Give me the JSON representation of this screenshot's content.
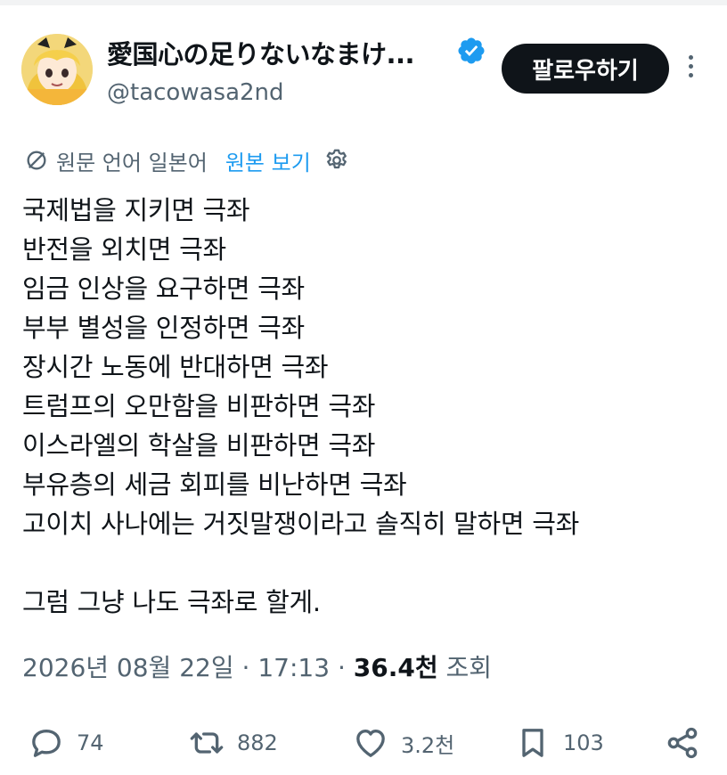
{
  "author": {
    "display_name": "愛国心の足りないなまけ...",
    "handle": "@tacowasa2nd"
  },
  "follow_label": "팔로우하기",
  "translation": {
    "original_language": "원문 언어 일본어",
    "view_original": "원본 보기"
  },
  "tweet_lines": [
    "국제법을 지키면 극좌",
    "반전을 외치면 극좌",
    "임금 인상을 요구하면 극좌",
    "부부 별성을 인정하면 극좌",
    "장시간 노동에 반대하면 극좌",
    "트럼프의 오만함을 비판하면 극좌",
    "이스라엘의 학살을 비판하면 극좌",
    "부유층의 세금 회피를 비난하면 극좌",
    "고이치 사나에는 거짓말쟁이라고 솔직히 말하면 극좌",
    "그럼 그냥 나도 극좌로 할게."
  ],
  "meta": {
    "date": "2026년 08월 22일",
    "time": "17:13",
    "views_count": "36.4천",
    "views_label": "조회"
  },
  "actions": {
    "replies": "74",
    "retweets": "882",
    "likes": "3.2천",
    "bookmarks": "103"
  },
  "colors": {
    "accent": "#1d9bf0",
    "text": "#0f1419",
    "secondary": "#536471",
    "follow_button": "#0f1419"
  },
  "icons": [
    "verified-badge-icon",
    "more-icon",
    "translate-icon",
    "gear-icon",
    "reply-icon",
    "retweet-icon",
    "like-icon",
    "bookmark-icon",
    "share-icon"
  ]
}
